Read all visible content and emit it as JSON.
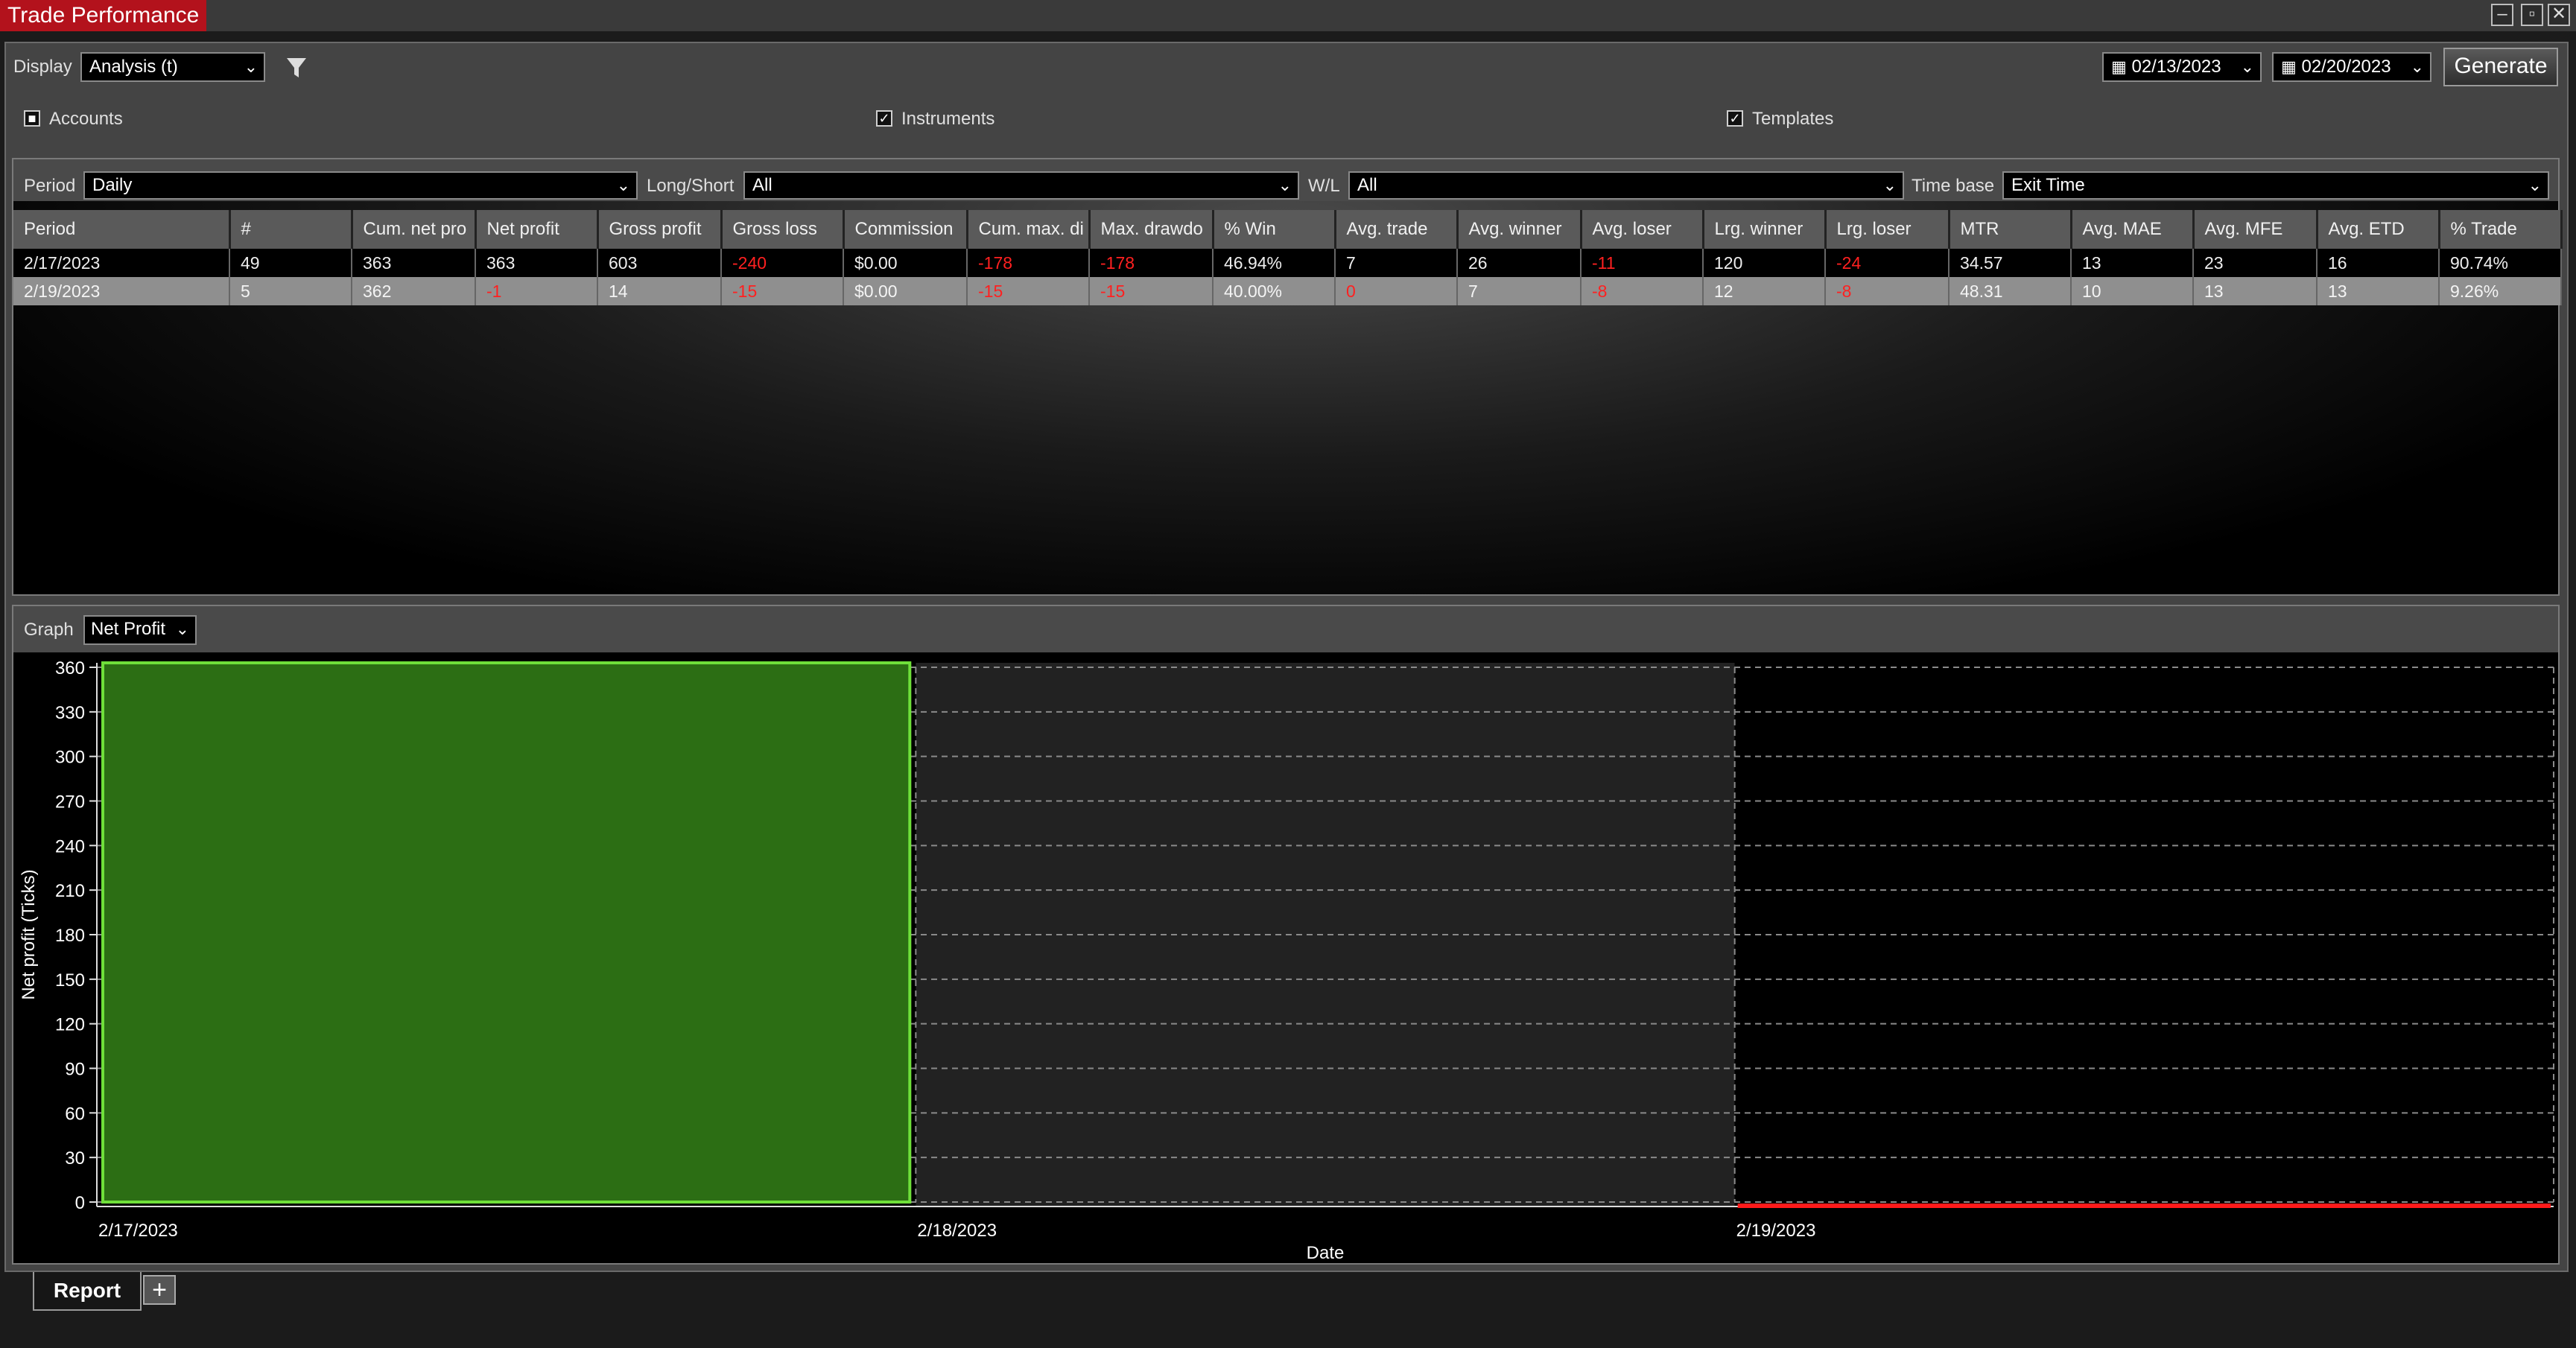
{
  "window": {
    "title": "Trade Performance"
  },
  "controls": {
    "display_label": "Display",
    "display_value": "Analysis (t)",
    "date_from": "02/13/2023",
    "date_to": "02/20/2023",
    "generate": "Generate",
    "accounts": "Accounts",
    "instruments": "Instruments",
    "templates": "Templates"
  },
  "filters": {
    "period_label": "Period",
    "period_value": "Daily",
    "longshort_label": "Long/Short",
    "longshort_value": "All",
    "wl_label": "W/L",
    "wl_value": "All",
    "timebase_label": "Time base",
    "timebase_value": "Exit Time"
  },
  "table": {
    "columns": [
      "Period",
      "#",
      "Cum. net pro",
      "Net profit",
      "Gross profit",
      "Gross loss",
      "Commission",
      "Cum. max. di",
      "Max. drawdo",
      "% Win",
      "Avg. trade",
      "Avg. winner",
      "Avg. loser",
      "Lrg. winner",
      "Lrg. loser",
      "MTR",
      "Avg. MAE",
      "Avg. MFE",
      "Avg. ETD",
      "% Trade"
    ],
    "rows": [
      [
        "2/17/2023",
        "49",
        "363",
        "363",
        "603",
        "-240",
        "$0.00",
        "-178",
        "-178",
        "46.94%",
        "7",
        "26",
        "-11",
        "120",
        "-24",
        "34.57",
        "13",
        "23",
        "16",
        "90.74%"
      ],
      [
        "2/19/2023",
        "5",
        "362",
        "-1",
        "14",
        "-15",
        "$0.00",
        "-15",
        "-15",
        "40.00%",
        "0",
        "7",
        "-8",
        "12",
        "-8",
        "48.31",
        "10",
        "13",
        "13",
        "9.26%"
      ]
    ],
    "negative_color": "#ff2020"
  },
  "graph": {
    "label": "Graph",
    "selected": "Net Profit"
  },
  "chart_data": {
    "type": "bar",
    "categories": [
      "2/17/2023",
      "2/18/2023",
      "2/19/2023"
    ],
    "values": [
      363,
      null,
      -1
    ],
    "xlabel": "Date",
    "ylabel": "Net profit (Ticks)",
    "ylim": [
      0,
      360
    ],
    "yticks": [
      0,
      30,
      60,
      90,
      120,
      150,
      180,
      210,
      240,
      270,
      300,
      330,
      360
    ],
    "grid": true,
    "colors": {
      "positive": "#2c6e14",
      "positive_border": "#6fe03a",
      "negative": "#ff1a1a"
    }
  },
  "tabs": {
    "active": "Report",
    "add": "+"
  }
}
